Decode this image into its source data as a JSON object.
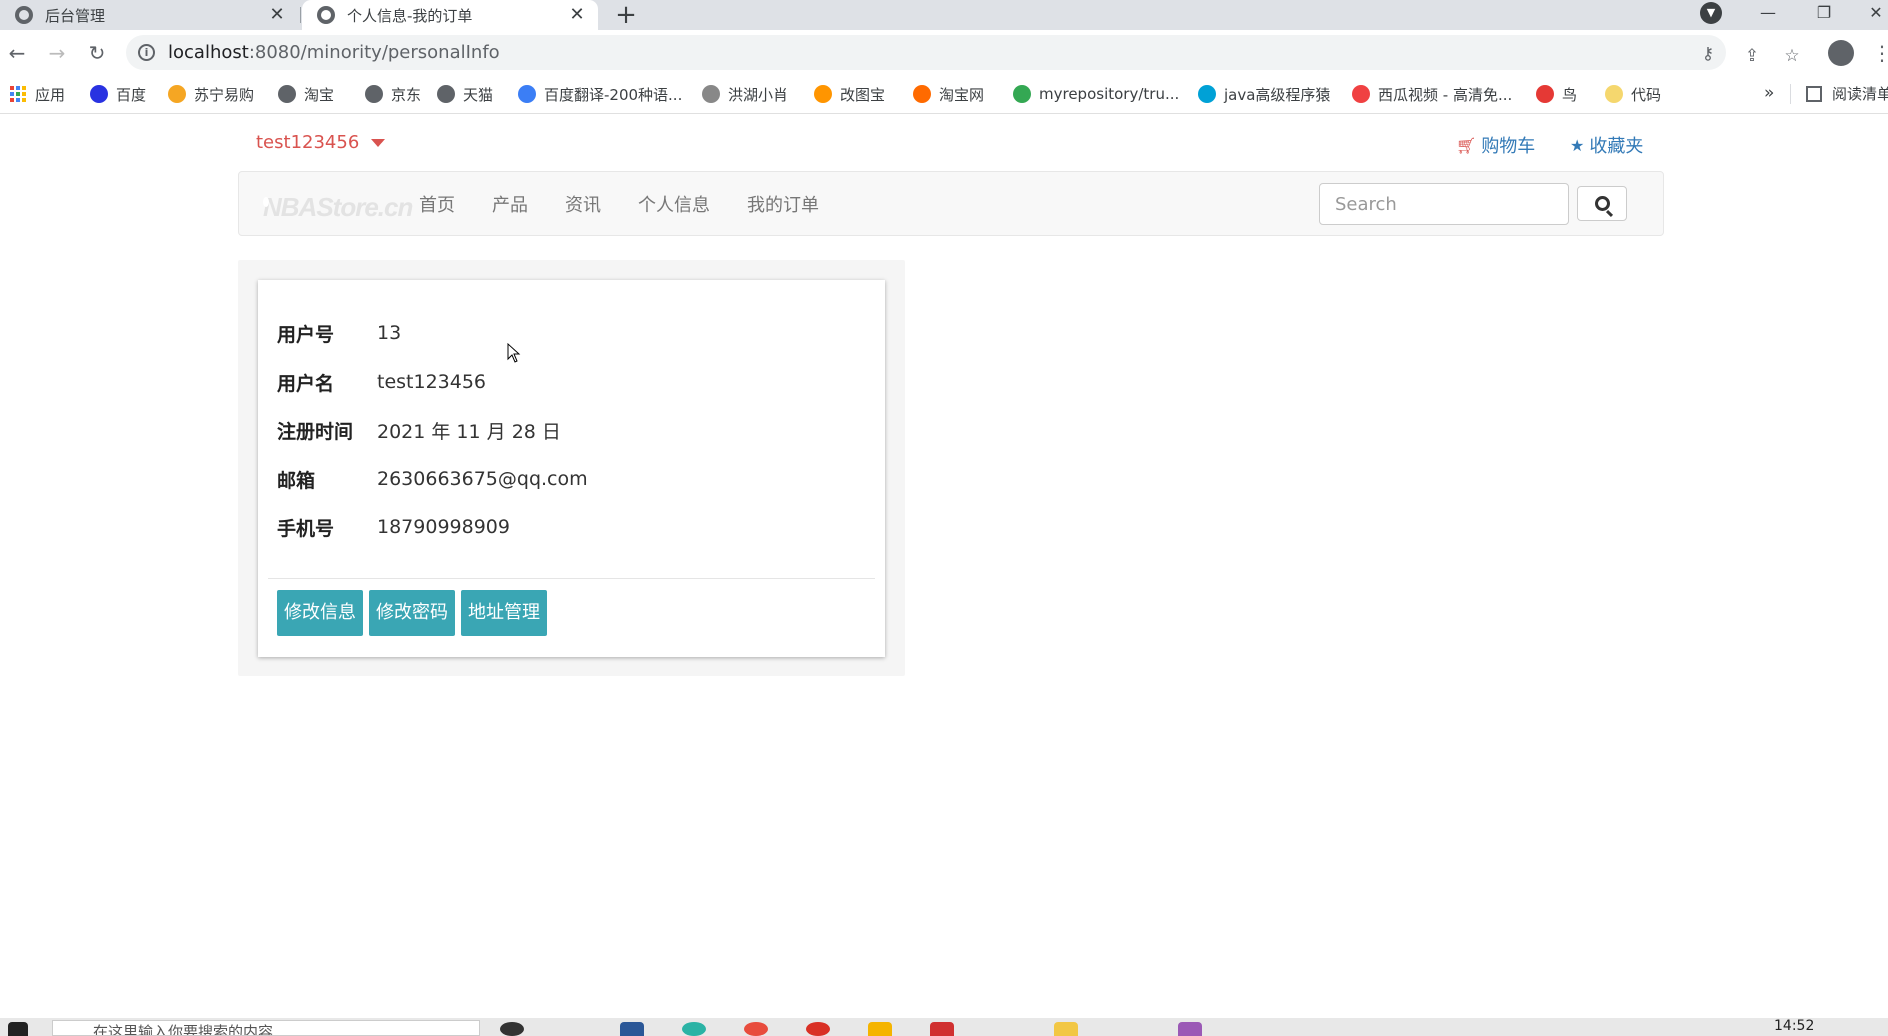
{
  "browser": {
    "tabs": [
      {
        "title": "后台管理",
        "active": false
      },
      {
        "title": "个人信息-我的订单",
        "active": true
      }
    ],
    "new_tab": "+",
    "url_host": "localhost",
    "url_rest": ":8080/minority/personalInfo"
  },
  "bookmarks": {
    "items": [
      {
        "label": "应用",
        "icon": "apps-grid-icon"
      },
      {
        "label": "百度",
        "icon": "baidu-icon",
        "color": "#2932e1"
      },
      {
        "label": "苏宁易购",
        "icon": "suning-icon",
        "color": "#f5a623"
      },
      {
        "label": "淘宝",
        "icon": "globe-icon",
        "color": "#5f6368"
      },
      {
        "label": "京东",
        "icon": "globe-icon",
        "color": "#5f6368"
      },
      {
        "label": "天猫",
        "icon": "globe-icon",
        "color": "#5f6368"
      },
      {
        "label": "百度翻译-200种语...",
        "icon": "translate-icon",
        "color": "#3b7ef5"
      },
      {
        "label": "洪湖小肖",
        "icon": "bird-icon",
        "color": "#888888"
      },
      {
        "label": "改图宝",
        "icon": "gaitubao-icon",
        "color": "#ff9500"
      },
      {
        "label": "淘宝网",
        "icon": "taobao-icon",
        "color": "#ff6a00"
      },
      {
        "label": "myrepository/tru...",
        "icon": "chrome-icon",
        "color": "#34a853"
      },
      {
        "label": "java高级程序猿",
        "icon": "bilibili-icon",
        "color": "#00a1d6"
      },
      {
        "label": "西瓜视频 - 高清免...",
        "icon": "xigua-icon",
        "color": "#f04142"
      },
      {
        "label": "鸟",
        "icon": "bird-red-icon",
        "color": "#e53935"
      },
      {
        "label": "代码",
        "icon": "code-icon",
        "color": "#f5d76e"
      }
    ],
    "more": "»",
    "reading_list": "阅读清单"
  },
  "page": {
    "username": "test123456",
    "cart_label": "购物车",
    "favorites_label": "收藏夹",
    "nav": [
      "首页",
      "产品",
      "资讯",
      "个人信息",
      "我的订单"
    ],
    "brand_text": "NBAStore.cn",
    "search_placeholder": "Search",
    "profile": [
      {
        "key": "用户号",
        "value": "13"
      },
      {
        "key": "用户名",
        "value": "test123456"
      },
      {
        "key": "注册时间",
        "value": "2021 年 11 月 28 日"
      },
      {
        "key": "邮箱",
        "value": "2630663675@qq.com"
      },
      {
        "key": "手机号",
        "value": "18790998909"
      }
    ],
    "buttons": {
      "edit_info": "修改信息",
      "change_password": "修改密码",
      "address_manage": "地址管理"
    }
  },
  "taskbar": {
    "search_text": "在这里输入你要搜索的内容",
    "time": "14:52"
  },
  "colors": {
    "accent_button": "#3aa6b4",
    "user_link": "#d9534f",
    "link": "#337ab7"
  }
}
